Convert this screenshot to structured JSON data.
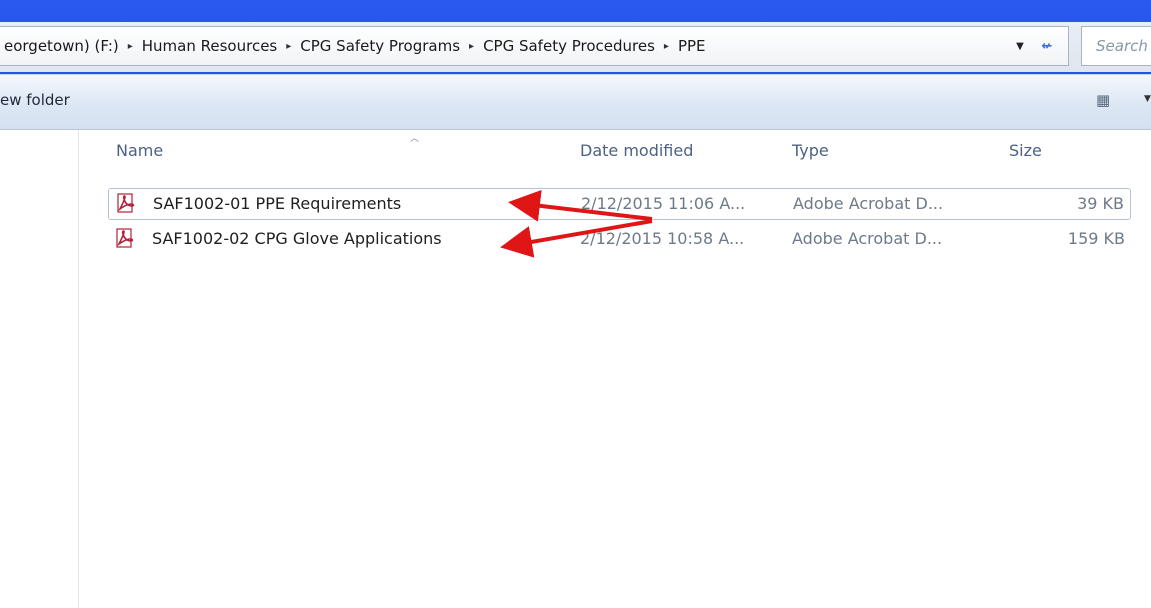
{
  "address": {
    "crumbs": [
      "eorgetown) (F:)",
      "Human Resources",
      "CPG Safety Programs",
      "CPG Safety Procedures",
      "PPE"
    ],
    "separator": "▸",
    "dropdown_icon": "chevron-down-icon",
    "refresh_icon": "refresh-icon",
    "refresh_glyph": "↚",
    "search_placeholder": "Search"
  },
  "toolbar": {
    "new_folder_label": "ew folder",
    "views_icon": "views-icon",
    "views_glyph": "▦"
  },
  "columns": {
    "name": "Name",
    "date": "Date modified",
    "type": "Type",
    "size": "Size"
  },
  "files": [
    {
      "name": "SAF1002-01 PPE Requirements",
      "date": "2/12/2015 11:06 A...",
      "type": "Adobe Acrobat D...",
      "size": "39 KB",
      "icon": "pdf-icon"
    },
    {
      "name": "SAF1002-02 CPG Glove Applications",
      "date": "2/12/2015 10:58 A...",
      "type": "Adobe Acrobat D...",
      "size": "159 KB",
      "icon": "pdf-icon"
    }
  ],
  "colors": {
    "background_border": "#0a2bd6",
    "annotation_arrow": "#e01515",
    "pdf_icon": "#b3203a",
    "column_header": "#4d6185"
  }
}
